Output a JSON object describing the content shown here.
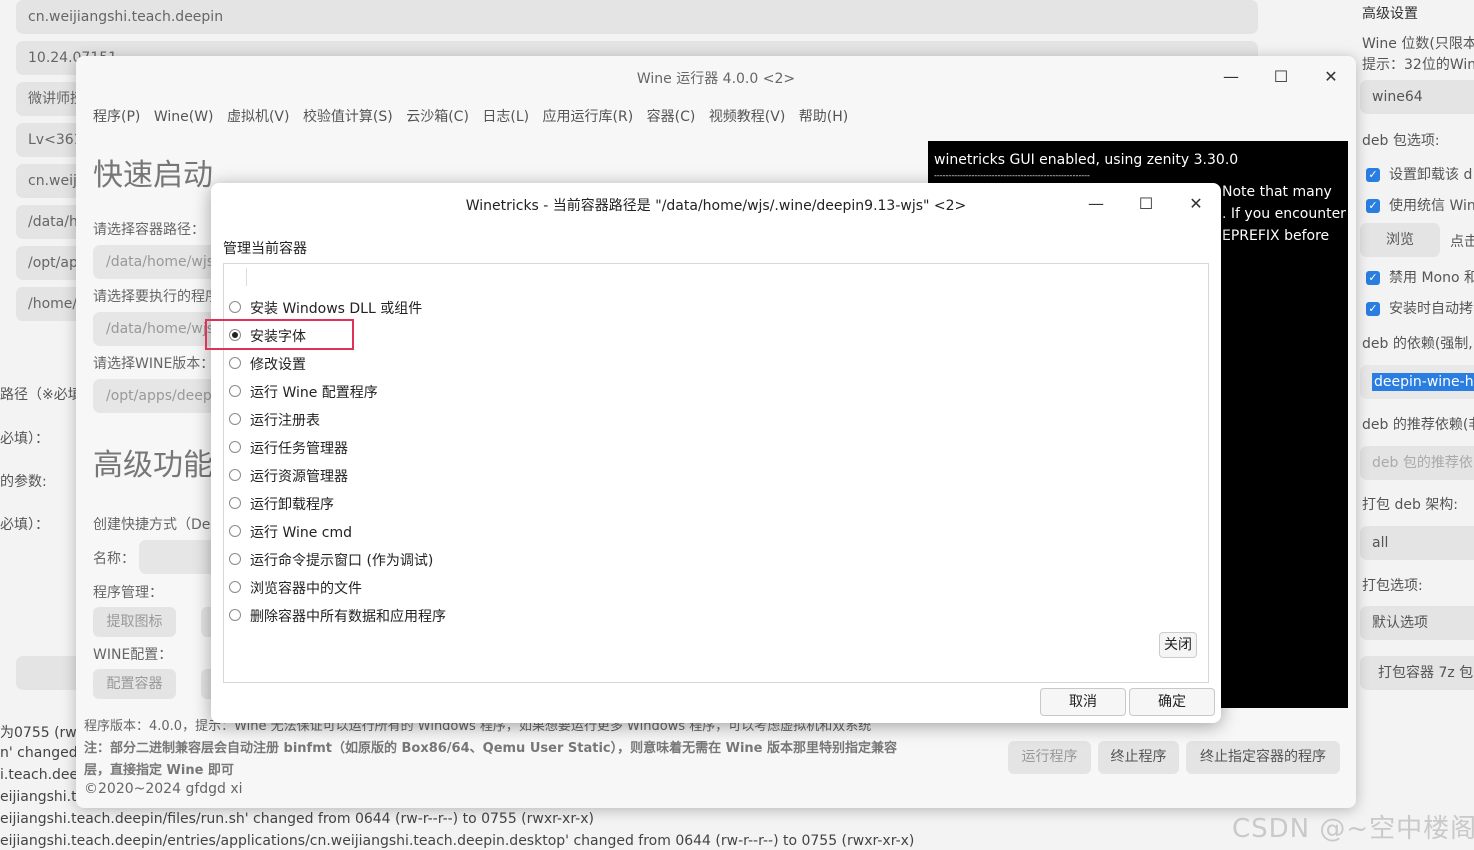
{
  "background": {
    "fields": [
      "cn.weijiangshi.teach.deepin",
      "10.24.07151",
      "微讲师授",
      "Lv<3614",
      "cn.weiji",
      "/data/h",
      "/opt/app",
      "/home/"
    ],
    "labels": [
      "路径（※必填",
      "必填）：",
      "的参数:",
      "必填）："
    ],
    "terminal_lines": [
      "为0755 (rwx",
      "n' changed f",
      "i.teach.deep",
      "eijiangshi.te",
      "eijiangshi.teach.deepin/files/run.sh' changed from 0644 (rw-r--r--) to 0755 (rwxr-xr-x)",
      "eijiangshi.teach.deepin/entries/applications/cn.weijiangshi.teach.deepin.desktop' changed from 0644 (rw-r--r--) to 0755 (rwxr-xr-x)"
    ]
  },
  "right_panel": {
    "heading": "高级设置",
    "wine_bits_label": "Wine 位数(只限本",
    "hint": "提示：32位的Wine",
    "wine_bits_value": "wine64",
    "deb_options_label": "deb 包选项:",
    "check1": "设置卸载该 d",
    "check2": "使用统信 Win",
    "browse": "浏览",
    "click": "点击",
    "check3": "禁用 Mono 和",
    "check4": "安装时自动拷",
    "deps_label": "deb 的依赖(强制,",
    "deps_value": "deepin-wine-he",
    "recommends_label": "deb 的推荐依赖(非",
    "recommends_placeholder": "deb 包的推荐依",
    "arch_label": "打包 deb 架构:",
    "arch_value": "all",
    "pack_options_label": "打包选项:",
    "pack_options_value": "默认选项",
    "pack_button": "打包容器 7z 包"
  },
  "wine_window": {
    "title": "Wine 运行器 4.0.0 <2>",
    "controls": {
      "minimize": "—",
      "maximize": "☐",
      "close": "✕"
    },
    "menu": [
      "程序(P)",
      "Wine(W)",
      "虚拟机(V)",
      "校验值计算(S)",
      "云沙箱(C)",
      "日志(L)",
      "应用运行库(R)",
      "容器(C)",
      "视频教程(V)",
      "帮助(H)"
    ],
    "quick_start": "快速启动",
    "container_path_label": "请选择容器路径：",
    "container_path_value": "/data/home/wjs",
    "program_label": "请选择要执行的程序",
    "program_value": "/data/home/wjs",
    "wine_version_label": "请选择WINE版本：",
    "wine_version_value": "/opt/apps/deepin",
    "advanced": "高级功能",
    "shortcut_label": "创建快捷方式（Des",
    "name_label": "名称：",
    "program_mgmt_label": "程序管理：",
    "extract_icon": "提取图标",
    "wine_config_label": "WINE配置：",
    "config_container": "配置容器",
    "version_text": "程序版本：4.0.0，提示：Wine 无法保证可以运行所有的 Windows 程序，如果想要运行更多 Windows 程序，可以考虑虚拟机和双系统",
    "note_text": "注：部分二进制兼容层会自动注册 binfmt（如原版的 Box86/64、Qemu User Static），则意味着无需在 Wine 版本那里特别指定兼容",
    "note_text2": "层，直接指定 Wine 即可",
    "copyright": "©2020~2024 gfdgd xi",
    "run_button": "运行程序",
    "stop_button": "终止程序",
    "stop_container_button": "终止指定容器的程序",
    "terminal": [
      "winetricks GUI enabled, using zenity 3.30.0",
      "------------------------------------------------------",
      "Note that many",
      ". If you encounter",
      "EPREFIX before"
    ]
  },
  "winetricks": {
    "title": "Winetricks - 当前容器路径是 \"/data/home/wjs/.wine/deepin9.13-wjs\" <2>",
    "section_label": "管理当前容器",
    "options": [
      {
        "label": "安装 Windows DLL 或组件",
        "selected": false
      },
      {
        "label": "安装字体",
        "selected": true
      },
      {
        "label": "修改设置",
        "selected": false
      },
      {
        "label": "运行 Wine 配置程序",
        "selected": false
      },
      {
        "label": "运行注册表",
        "selected": false
      },
      {
        "label": "运行任务管理器",
        "selected": false
      },
      {
        "label": "运行资源管理器",
        "selected": false
      },
      {
        "label": "运行卸载程序",
        "selected": false
      },
      {
        "label": "运行 Wine cmd",
        "selected": false
      },
      {
        "label": "运行命令提示窗口 (作为调试)",
        "selected": false
      },
      {
        "label": "浏览容器中的文件",
        "selected": false
      },
      {
        "label": "删除容器中所有数据和应用程序",
        "selected": false
      }
    ],
    "close_label": "关闭",
    "cancel": "取消",
    "ok": "确定"
  },
  "watermark": "CSDN @~空中楼阁"
}
